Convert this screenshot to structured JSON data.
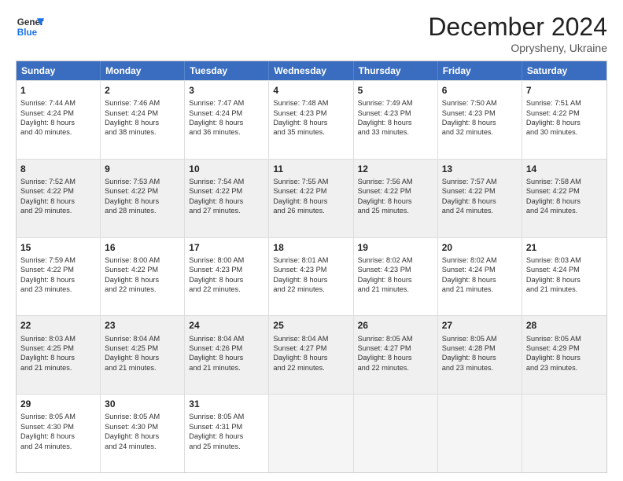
{
  "logo": {
    "line1": "General",
    "line2": "Blue"
  },
  "title": "December 2024",
  "location": "Oprysheny, Ukraine",
  "days_of_week": [
    "Sunday",
    "Monday",
    "Tuesday",
    "Wednesday",
    "Thursday",
    "Friday",
    "Saturday"
  ],
  "weeks": [
    [
      {
        "day": "1",
        "info": "Sunrise: 7:44 AM\nSunset: 4:24 PM\nDaylight: 8 hours\nand 40 minutes."
      },
      {
        "day": "2",
        "info": "Sunrise: 7:46 AM\nSunset: 4:24 PM\nDaylight: 8 hours\nand 38 minutes."
      },
      {
        "day": "3",
        "info": "Sunrise: 7:47 AM\nSunset: 4:24 PM\nDaylight: 8 hours\nand 36 minutes."
      },
      {
        "day": "4",
        "info": "Sunrise: 7:48 AM\nSunset: 4:23 PM\nDaylight: 8 hours\nand 35 minutes."
      },
      {
        "day": "5",
        "info": "Sunrise: 7:49 AM\nSunset: 4:23 PM\nDaylight: 8 hours\nand 33 minutes."
      },
      {
        "day": "6",
        "info": "Sunrise: 7:50 AM\nSunset: 4:23 PM\nDaylight: 8 hours\nand 32 minutes."
      },
      {
        "day": "7",
        "info": "Sunrise: 7:51 AM\nSunset: 4:22 PM\nDaylight: 8 hours\nand 30 minutes."
      }
    ],
    [
      {
        "day": "8",
        "info": "Sunrise: 7:52 AM\nSunset: 4:22 PM\nDaylight: 8 hours\nand 29 minutes."
      },
      {
        "day": "9",
        "info": "Sunrise: 7:53 AM\nSunset: 4:22 PM\nDaylight: 8 hours\nand 28 minutes."
      },
      {
        "day": "10",
        "info": "Sunrise: 7:54 AM\nSunset: 4:22 PM\nDaylight: 8 hours\nand 27 minutes."
      },
      {
        "day": "11",
        "info": "Sunrise: 7:55 AM\nSunset: 4:22 PM\nDaylight: 8 hours\nand 26 minutes."
      },
      {
        "day": "12",
        "info": "Sunrise: 7:56 AM\nSunset: 4:22 PM\nDaylight: 8 hours\nand 25 minutes."
      },
      {
        "day": "13",
        "info": "Sunrise: 7:57 AM\nSunset: 4:22 PM\nDaylight: 8 hours\nand 24 minutes."
      },
      {
        "day": "14",
        "info": "Sunrise: 7:58 AM\nSunset: 4:22 PM\nDaylight: 8 hours\nand 24 minutes."
      }
    ],
    [
      {
        "day": "15",
        "info": "Sunrise: 7:59 AM\nSunset: 4:22 PM\nDaylight: 8 hours\nand 23 minutes."
      },
      {
        "day": "16",
        "info": "Sunrise: 8:00 AM\nSunset: 4:22 PM\nDaylight: 8 hours\nand 22 minutes."
      },
      {
        "day": "17",
        "info": "Sunrise: 8:00 AM\nSunset: 4:23 PM\nDaylight: 8 hours\nand 22 minutes."
      },
      {
        "day": "18",
        "info": "Sunrise: 8:01 AM\nSunset: 4:23 PM\nDaylight: 8 hours\nand 22 minutes."
      },
      {
        "day": "19",
        "info": "Sunrise: 8:02 AM\nSunset: 4:23 PM\nDaylight: 8 hours\nand 21 minutes."
      },
      {
        "day": "20",
        "info": "Sunrise: 8:02 AM\nSunset: 4:24 PM\nDaylight: 8 hours\nand 21 minutes."
      },
      {
        "day": "21",
        "info": "Sunrise: 8:03 AM\nSunset: 4:24 PM\nDaylight: 8 hours\nand 21 minutes."
      }
    ],
    [
      {
        "day": "22",
        "info": "Sunrise: 8:03 AM\nSunset: 4:25 PM\nDaylight: 8 hours\nand 21 minutes."
      },
      {
        "day": "23",
        "info": "Sunrise: 8:04 AM\nSunset: 4:25 PM\nDaylight: 8 hours\nand 21 minutes."
      },
      {
        "day": "24",
        "info": "Sunrise: 8:04 AM\nSunset: 4:26 PM\nDaylight: 8 hours\nand 21 minutes."
      },
      {
        "day": "25",
        "info": "Sunrise: 8:04 AM\nSunset: 4:27 PM\nDaylight: 8 hours\nand 22 minutes."
      },
      {
        "day": "26",
        "info": "Sunrise: 8:05 AM\nSunset: 4:27 PM\nDaylight: 8 hours\nand 22 minutes."
      },
      {
        "day": "27",
        "info": "Sunrise: 8:05 AM\nSunset: 4:28 PM\nDaylight: 8 hours\nand 23 minutes."
      },
      {
        "day": "28",
        "info": "Sunrise: 8:05 AM\nSunset: 4:29 PM\nDaylight: 8 hours\nand 23 minutes."
      }
    ],
    [
      {
        "day": "29",
        "info": "Sunrise: 8:05 AM\nSunset: 4:30 PM\nDaylight: 8 hours\nand 24 minutes."
      },
      {
        "day": "30",
        "info": "Sunrise: 8:05 AM\nSunset: 4:30 PM\nDaylight: 8 hours\nand 24 minutes."
      },
      {
        "day": "31",
        "info": "Sunrise: 8:05 AM\nSunset: 4:31 PM\nDaylight: 8 hours\nand 25 minutes."
      },
      {
        "day": "",
        "info": ""
      },
      {
        "day": "",
        "info": ""
      },
      {
        "day": "",
        "info": ""
      },
      {
        "day": "",
        "info": ""
      }
    ]
  ]
}
